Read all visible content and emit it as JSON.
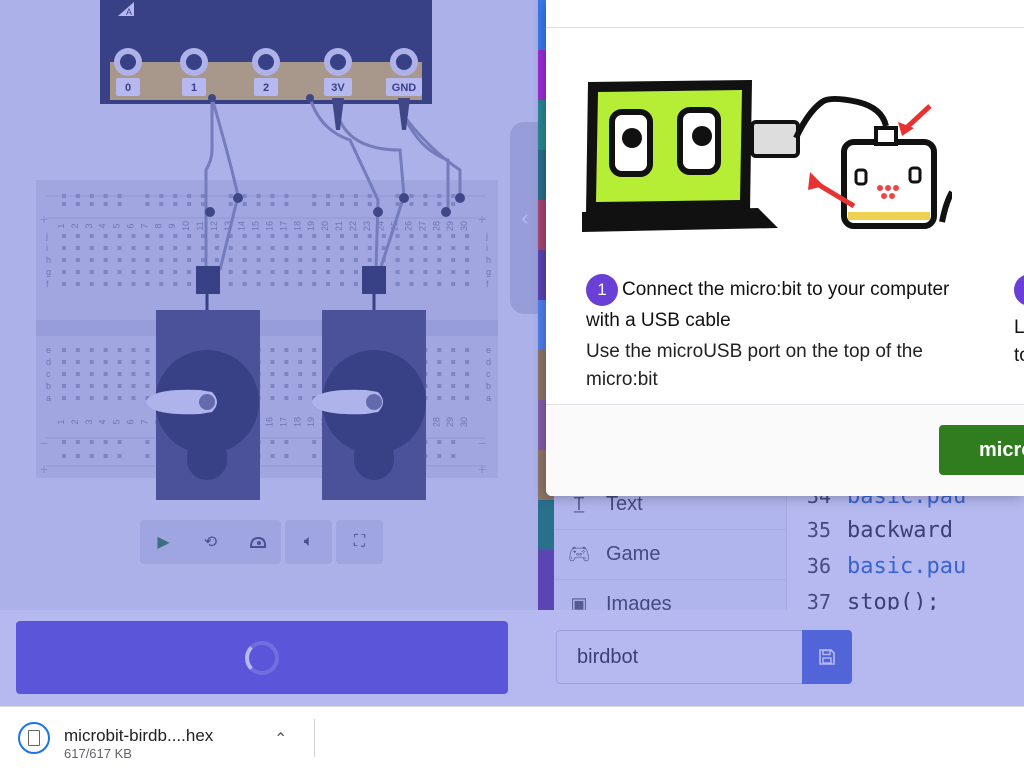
{
  "simulator": {
    "pin_labels": [
      "0",
      "1",
      "2",
      "3V",
      "GND"
    ],
    "logo_letter": "A",
    "row_letters_top": [
      "j",
      "i",
      "h",
      "g",
      "f"
    ],
    "row_letters_bottom": [
      "e",
      "d",
      "c",
      "b",
      "a"
    ],
    "column_numbers": [
      "1",
      "2",
      "3",
      "4",
      "5",
      "6",
      "7",
      "8",
      "9",
      "10",
      "11",
      "12",
      "13",
      "14",
      "15",
      "16",
      "17",
      "18",
      "19",
      "20",
      "21",
      "22",
      "23",
      "24",
      "25",
      "26",
      "27",
      "28",
      "29",
      "30"
    ],
    "toolbar_icons": [
      "play-icon",
      "restart-icon",
      "slow-mo-icon",
      "sound-icon",
      "fullscreen-icon"
    ]
  },
  "toolbox": {
    "items": [
      {
        "label": "Text",
        "icon": "text-icon",
        "color": "#b8860b"
      },
      {
        "label": "Game",
        "icon": "gamepad-icon",
        "color": "#007a4d"
      },
      {
        "label": "Images",
        "icon": "image-icon",
        "color": "#5c2d91"
      }
    ]
  },
  "code": {
    "lines": [
      {
        "num": "34",
        "text": "basic.pau",
        "kw": true
      },
      {
        "num": "35",
        "text": "backward",
        "kw": false
      },
      {
        "num": "36",
        "text": "basic.pau",
        "kw": true
      },
      {
        "num": "37",
        "text": "stop();",
        "kw": false
      }
    ]
  },
  "modal": {
    "step_number": "1",
    "step_title": "Connect the micro:bit to your computer with a USB cable",
    "step_description": "Use the microUSB port on the top of the micro:bit",
    "next_step_partial": "L\nto",
    "primary_button_label": "micro"
  },
  "bottom": {
    "project_name": "birdbot"
  },
  "download": {
    "file_name": "microbit-birdb....hex",
    "file_size": "617/617 KB"
  },
  "colors": {
    "overlay": "rgba(90,100,220,0.45)",
    "download_button": "#5b4ad8",
    "save_button": "#4a66d8",
    "step_badge": "#6a3fd6",
    "primary_button": "#2f7d1f"
  }
}
